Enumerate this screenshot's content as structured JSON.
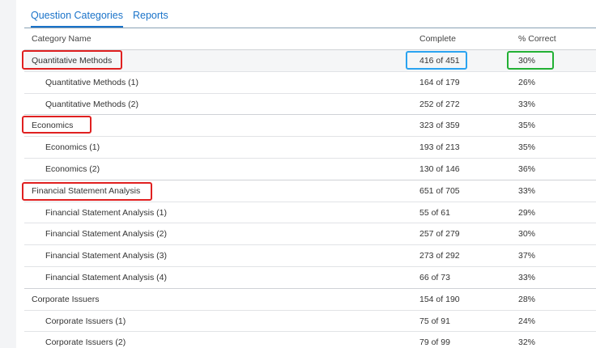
{
  "tabs": [
    {
      "label": "Question Categories",
      "active": true
    },
    {
      "label": "Reports",
      "active": false
    }
  ],
  "columns": {
    "name": "Category Name",
    "complete": "Complete",
    "correct": "% Correct"
  },
  "rows": [
    {
      "name": "Quantitative Methods",
      "complete": "416 of 451",
      "correct": "30%",
      "level": "top"
    },
    {
      "name": "Quantitative Methods (1)",
      "complete": "164 of 179",
      "correct": "26%",
      "level": "sub"
    },
    {
      "name": "Quantitative Methods (2)",
      "complete": "252 of 272",
      "correct": "33%",
      "level": "sub"
    },
    {
      "name": "Economics",
      "complete": "323 of 359",
      "correct": "35%",
      "level": "top"
    },
    {
      "name": "Economics (1)",
      "complete": "193 of 213",
      "correct": "35%",
      "level": "sub"
    },
    {
      "name": "Economics (2)",
      "complete": "130 of 146",
      "correct": "36%",
      "level": "sub"
    },
    {
      "name": "Financial Statement Analysis",
      "complete": "651 of 705",
      "correct": "33%",
      "level": "top"
    },
    {
      "name": "Financial Statement Analysis (1)",
      "complete": "55 of 61",
      "correct": "29%",
      "level": "sub"
    },
    {
      "name": "Financial Statement Analysis (2)",
      "complete": "257 of 279",
      "correct": "30%",
      "level": "sub"
    },
    {
      "name": "Financial Statement Analysis (3)",
      "complete": "273 of 292",
      "correct": "37%",
      "level": "sub"
    },
    {
      "name": "Financial Statement Analysis (4)",
      "complete": "66 of 73",
      "correct": "33%",
      "level": "sub"
    },
    {
      "name": "Corporate Issuers",
      "complete": "154 of 190",
      "correct": "28%",
      "level": "top"
    },
    {
      "name": "Corporate Issuers (1)",
      "complete": "75 of 91",
      "correct": "24%",
      "level": "sub"
    },
    {
      "name": "Corporate Issuers (2)",
      "complete": "79 of 99",
      "correct": "32%",
      "level": "sub"
    }
  ],
  "colors": {
    "accent": "#1a73c9",
    "annotation_red": "#e02020",
    "annotation_blue": "#2aa3f0",
    "annotation_green": "#22b034"
  }
}
